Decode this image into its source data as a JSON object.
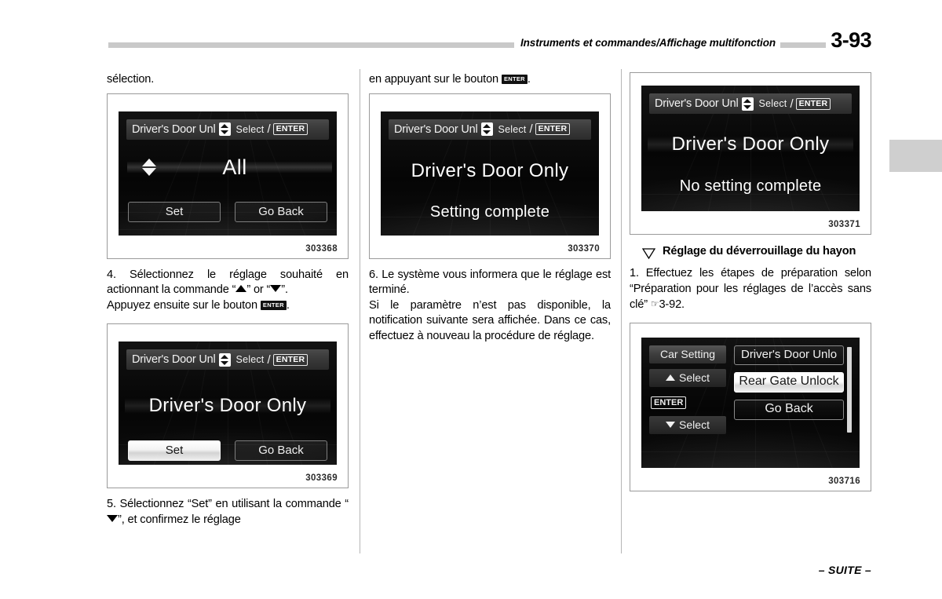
{
  "header": {
    "title": "Instruments et commandes/Affichage multifonction",
    "page_number": "3-93"
  },
  "footer": {
    "continued": "– SUITE –"
  },
  "columns": {
    "col1": {
      "top_text": "sélection.",
      "figure1": {
        "caption": "303368",
        "titlebar": {
          "main": "Driver's Door Unl",
          "updown_icon": "up-down-arrow-icon",
          "select": "Select",
          "slash": "/",
          "enter": "ENTER"
        },
        "value": "All",
        "arrows_icon": "up-down-arrow-icon",
        "buttons": [
          {
            "label": "Set",
            "highlighted": false
          },
          {
            "label": "Go Back",
            "highlighted": false
          }
        ]
      },
      "step4_a": "4. Sélectionnez le réglage souhaité en actionnant la commande “",
      "step4_b": "” or “",
      "step4_c": "”.",
      "step4_d": "Appuyez ensuite sur le bouton ",
      "step4_enter": "ENTER",
      "step4_e": ".",
      "figure2": {
        "caption": "303369",
        "titlebar": {
          "main": "Driver's Door Unl",
          "updown_icon": "up-down-arrow-icon",
          "select": "Select",
          "slash": "/",
          "enter": "ENTER"
        },
        "value": "Driver's Door Only",
        "buttons": [
          {
            "label": "Set",
            "highlighted": true
          },
          {
            "label": "Go Back",
            "highlighted": false
          }
        ]
      },
      "step5_a": "5. Sélectionnez “Set” en utilisant la commande “",
      "step5_b": "”, et confirmez le réglage"
    },
    "col2": {
      "top_text_a": "en appuyant sur le bouton ",
      "top_enter": "ENTER",
      "top_text_b": ".",
      "figure3": {
        "caption": "303370",
        "titlebar": {
          "main": "Driver's Door Unl",
          "updown_icon": "up-down-arrow-icon",
          "select": "Select",
          "slash": "/",
          "enter": "ENTER"
        },
        "line1": "Driver's Door Only",
        "line2": "Setting complete"
      },
      "step6": "6. Le système vous informera que le réglage est terminé.",
      "note": "Si le paramètre n’est pas disponible, la notification suivante sera affichée. Dans ce cas, effectuez à nouveau la procédure de réglage."
    },
    "col3": {
      "figure4": {
        "caption": "303371",
        "titlebar": {
          "main": "Driver's Door Unl",
          "updown_icon": "up-down-arrow-icon",
          "select": "Select",
          "slash": "/",
          "enter": "ENTER"
        },
        "line1": "Driver's Door Only",
        "line2": "No setting complete"
      },
      "section_marker_icon": "triangle-down-outline-icon",
      "section_title": "Réglage du déverrouillage du hayon",
      "step1_a": "1. Effectuez les étapes de préparation selon “Préparation pour les réglages de l’accès sans clé” ",
      "step1_hand": "☞",
      "step1_b": "3-92.",
      "figure5": {
        "caption": "303716",
        "left_keys": [
          {
            "label": "Car Setting",
            "icon": ""
          },
          {
            "label": "Select",
            "icon": "triangle-up-icon"
          },
          {
            "label": "ENTER",
            "icon": "enter-key-icon"
          },
          {
            "label": "Select",
            "icon": "triangle-down-icon"
          }
        ],
        "menu_items": [
          {
            "label": "Driver's Door Unlo",
            "selected": false
          },
          {
            "label": "Rear Gate Unlock",
            "selected": true
          },
          {
            "label": "Go Back",
            "selected": false
          }
        ],
        "scrollbar_icon": "scrollbar"
      }
    }
  }
}
